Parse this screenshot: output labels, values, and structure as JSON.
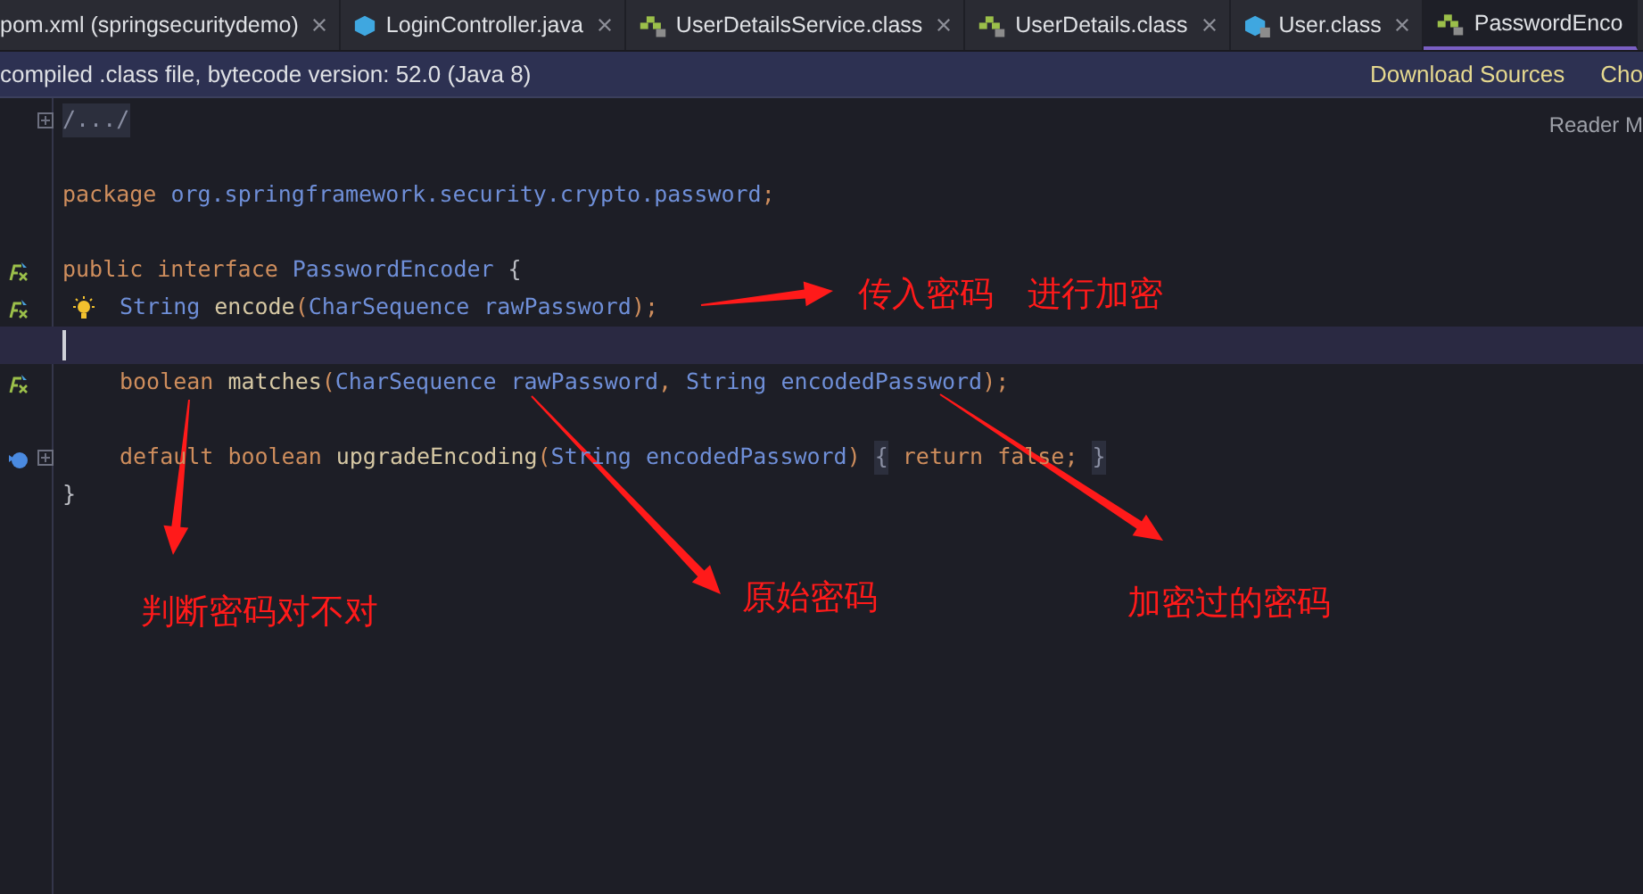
{
  "tabs": [
    {
      "label": "pom.xml (springsecuritydemo)",
      "kind": "file",
      "selected": false
    },
    {
      "label": "LoginController.java",
      "kind": "class",
      "selected": false
    },
    {
      "label": "UserDetailsService.class",
      "kind": "interface",
      "selected": false
    },
    {
      "label": "UserDetails.class",
      "kind": "interface",
      "selected": false
    },
    {
      "label": "User.class",
      "kind": "compiled",
      "selected": false
    },
    {
      "label": "PasswordEnco",
      "kind": "interface",
      "selected": true
    }
  ],
  "info_bar": {
    "message": "compiled .class file, bytecode version: 52.0 (Java 8)",
    "links": [
      "Download Sources",
      "Cho"
    ]
  },
  "reader_mode": "Reader M",
  "code_lines": [
    {
      "kind": "plain",
      "fold": true,
      "bulb": false,
      "indented": false,
      "current": false,
      "tokens": [
        {
          "text": "/.../",
          "kind": "folded"
        }
      ]
    },
    {
      "kind": "plain",
      "fold": false,
      "bulb": false,
      "current": false
    },
    {
      "kind": "plain",
      "fold": false,
      "bulb": false,
      "indented": false,
      "current": false,
      "tokens": [
        {
          "text": "package",
          "kind": "keyword"
        },
        {
          "text": "org.springframework.security.crypto.password",
          "kind": "type"
        },
        {
          "text": ";",
          "kind": "punct"
        }
      ]
    },
    {
      "kind": "plain",
      "fold": false,
      "bulb": false,
      "current": false
    },
    {
      "kind": "implemented",
      "fold": false,
      "bulb": false,
      "indented": false,
      "current": false,
      "tokens": [
        {
          "text": "public",
          "kind": "keyword"
        },
        {
          "text": "interface",
          "kind": "keyword"
        },
        {
          "text": "PasswordEncoder",
          "kind": "type"
        },
        {
          "text": "{",
          "kind": "plain"
        }
      ]
    },
    {
      "kind": "implemented",
      "fold": false,
      "bulb": true,
      "indented": true,
      "current": false,
      "tokens": [
        {
          "text": "String",
          "kind": "type"
        },
        {
          "text": "encode",
          "kind": "method"
        },
        {
          "text": "(",
          "kind": "punct"
        },
        {
          "text": "CharSequence",
          "kind": "type"
        },
        {
          "text": "rawPassword",
          "kind": "type"
        },
        {
          "text": ");",
          "kind": "punct"
        }
      ]
    },
    {
      "kind": "plain",
      "fold": false,
      "bulb": false,
      "current": true
    },
    {
      "kind": "implemented",
      "fold": false,
      "bulb": false,
      "indented": true,
      "current": false,
      "tokens": [
        {
          "text": "boolean",
          "kind": "keyword"
        },
        {
          "text": "matches",
          "kind": "method"
        },
        {
          "text": "(",
          "kind": "punct"
        },
        {
          "text": "CharSequence",
          "kind": "type"
        },
        {
          "text": "rawPassword",
          "kind": "type"
        },
        {
          "text": ",",
          "kind": "punct"
        },
        {
          "text": "String",
          "kind": "type"
        },
        {
          "text": "encodedPassword",
          "kind": "type"
        },
        {
          "text": ");",
          "kind": "punct"
        }
      ]
    },
    {
      "kind": "plain",
      "fold": false,
      "bulb": false,
      "current": false
    },
    {
      "kind": "overridden",
      "fold": true,
      "bulb": false,
      "indented": true,
      "current": false,
      "tokens": [
        {
          "text": "default",
          "kind": "keyword"
        },
        {
          "text": "boolean",
          "kind": "keyword"
        },
        {
          "text": "upgradeEncoding",
          "kind": "method"
        },
        {
          "text": "(",
          "kind": "punct"
        },
        {
          "text": "String",
          "kind": "type"
        },
        {
          "text": "encodedPassword",
          "kind": "type"
        },
        {
          "text": ")",
          "kind": "punct"
        },
        {
          "text": "{",
          "kind": "folded"
        },
        {
          "text": "return",
          "kind": "keyword"
        },
        {
          "text": "false;",
          "kind": "keyword"
        },
        {
          "text": "}",
          "kind": "folded"
        }
      ]
    },
    {
      "kind": "plain",
      "fold": false,
      "bulb": false,
      "indented": false,
      "current": false,
      "tokens": [
        {
          "text": "}",
          "kind": "plain"
        }
      ]
    }
  ],
  "annotations": [
    {
      "text": "传入密码　进行加密"
    },
    {
      "text": "判断密码对不对"
    },
    {
      "text": "原始密码"
    },
    {
      "text": "加密过的密码"
    }
  ]
}
